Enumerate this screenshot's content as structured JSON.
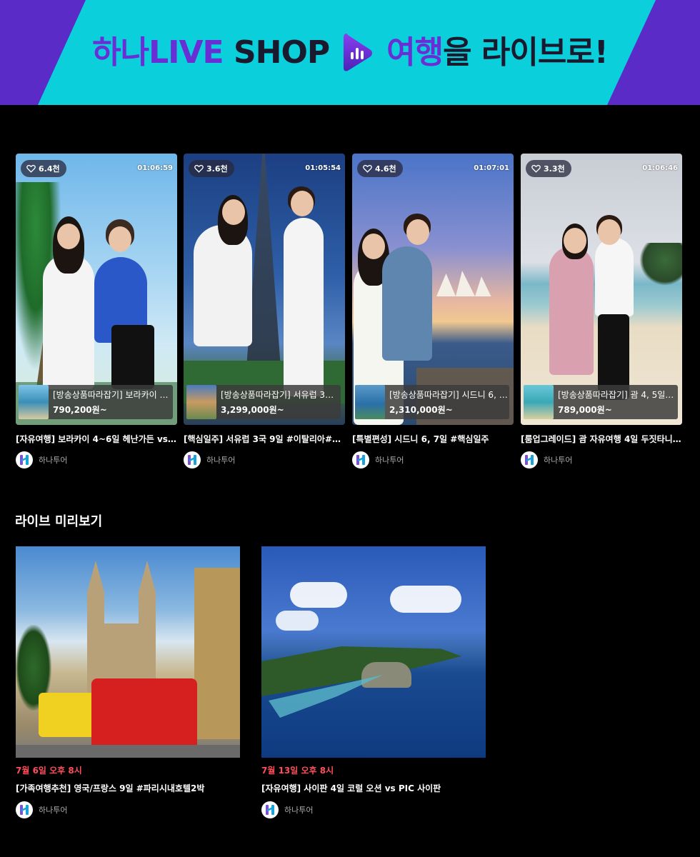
{
  "banner": {
    "brand": "하나LIVE",
    "shop": "SHOP",
    "slogan_highlight": "여행",
    "slogan_rest": "을 라이브로!",
    "colors": {
      "cyan": "#0bd0dc",
      "purple": "#5b2bc8",
      "brand_text": "#6a2fd4"
    }
  },
  "videos": [
    {
      "likes": "6.4천",
      "duration": "01:06:59",
      "product_name": "[방송상품따라잡기] 보라카이 자...",
      "product_price": "790,200원~",
      "title": "[자유여행] 보라카이 4~6일 헤난가든 vs 헤난…",
      "channel": "하나투어"
    },
    {
      "likes": "3.6천",
      "duration": "01:05:54",
      "product_name": "[방송상품따라잡기] 서유럽 3국 9...",
      "product_price": "3,299,000원~",
      "title": "[핵심일주] 서유럽 3국 9일 #이탈리아#스위스…",
      "channel": "하나투어"
    },
    {
      "likes": "4.6천",
      "duration": "01:07:01",
      "product_name": "[방송상품따라잡기] 시드니 6, 7...",
      "product_price": "2,310,000원~",
      "title": "[특별편성] 시드니 6, 7일 #핵심일주",
      "channel": "하나투어"
    },
    {
      "likes": "3.3천",
      "duration": "01:06:46",
      "product_name": "[방송상품따라잡기] 괌 4, 5일 #...",
      "product_price": "789,000원~",
      "title": "[룸업그레이드] 괌 자유여행 4일 두짓타니 vs …",
      "channel": "하나투어"
    }
  ],
  "preview_section": {
    "title": "라이브 미리보기",
    "items": [
      {
        "date": "7월 6일 오후 8시",
        "title": "[가족여행추천] 영국/프랑스 9일 #파리시내호텔2박",
        "channel": "하나투어"
      },
      {
        "date": "7월 13일 오후 8시",
        "title": "[자유여행] 사이판 4일 코럴 오션 vs PIC 사이판",
        "channel": "하나투어"
      }
    ]
  },
  "icons": [
    "heart-icon",
    "play-logo-icon",
    "hanatour-logo-icon"
  ]
}
